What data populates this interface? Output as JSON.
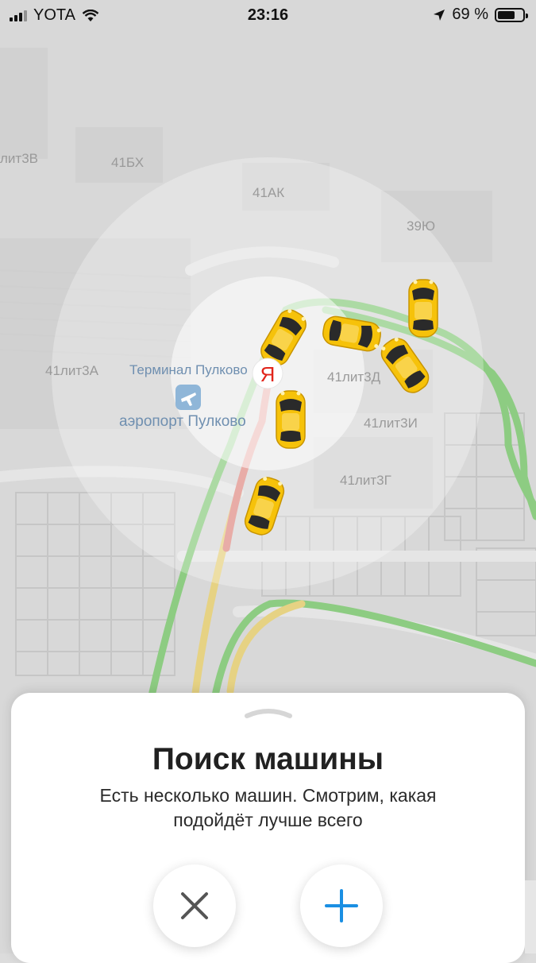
{
  "status_bar": {
    "carrier": "YOTA",
    "time": "23:16",
    "battery_percent_text": "69 %",
    "battery_level": 0.69,
    "icons": [
      "signal-icon",
      "wifi-icon",
      "location-arrow-icon",
      "battery-icon"
    ]
  },
  "map": {
    "labels": {
      "l41lit3v": "лит3В",
      "l41bx": "41БХ",
      "l41ak": "41АК",
      "l39yu": "39Ю",
      "l41lit3a": "41лит3А",
      "terminal": "Терминал Пулково",
      "airport": "аэропорт Пулково",
      "l41lit3d": "41лит3Д",
      "l41lit3i": "41лит3И",
      "l41lit3g": "41лит3Г"
    },
    "center_marker": "Я",
    "colors": {
      "marker": "#e1251b",
      "taxi": "#f6c20a",
      "traffic_green": "#6bcb5a",
      "traffic_red": "#e86a5e",
      "traffic_yellow": "#f3d55b"
    }
  },
  "sheet": {
    "title": "Поиск машины",
    "subtitle": "Есть несколько машин. Смотрим, какая подойдёт лучше всего",
    "cancel_icon": "close-icon",
    "add_icon": "plus-icon",
    "accent": "#1a8fe3"
  }
}
